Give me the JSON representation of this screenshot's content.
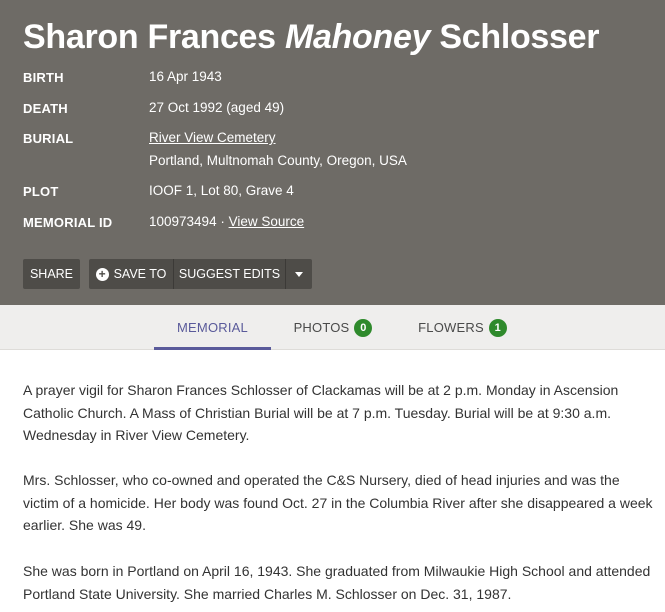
{
  "memorial": {
    "name_first": "Sharon Frances",
    "name_maiden": "Mahoney",
    "name_last": "Schlosser"
  },
  "facts": {
    "birth_label": "BIRTH",
    "birth_value": "16 Apr 1943",
    "death_label": "DEATH",
    "death_value": "27 Oct 1992 (aged 49)",
    "burial_label": "BURIAL",
    "burial_cemetery": "River View Cemetery",
    "burial_location": "Portland, Multnomah County, Oregon, USA",
    "plot_label": "PLOT",
    "plot_value": "IOOF 1, Lot 80, Grave 4",
    "memorial_id_label": "MEMORIAL ID",
    "memorial_id_value": "100973494 ·",
    "view_source": "View Source"
  },
  "actions": {
    "share": "SHARE",
    "save_to": "SAVE TO",
    "suggest_edits": "SUGGEST EDITS"
  },
  "tabs": {
    "memorial": "MEMORIAL",
    "photos": "PHOTOS",
    "photos_count": "0",
    "flowers": "FLOWERS",
    "flowers_count": "1"
  },
  "bio": {
    "p1": "A prayer vigil for Sharon Frances Schlosser of Clackamas will be at 2 p.m. Monday in Ascension Catholic Church. A Mass of Christian Burial will be at 7 p.m. Tuesday. Burial will be at 9:30 a.m. Wednesday in River View Cemetery.",
    "p2": "Mrs. Schlosser, who co-owned and operated the C&S Nursery, died of head injuries and was the victim of a homicide. Her body was found Oct. 27 in the Columbia River after she disappeared a week earlier. She was 49.",
    "p3": "She was born in Portland on April 16, 1943. She graduated from Milwaukie High School and attended Portland State University. She married Charles M. Schlosser on Dec. 31, 1987."
  },
  "colors": {
    "header_bg": "#6e6b66",
    "button_bg": "#4e4c48",
    "tab_active": "#5a5a9a",
    "badge_green": "#2f8a2c"
  },
  "icons": {
    "save_icon": "plus-circle-icon",
    "dropdown_icon": "caret-down-icon"
  }
}
